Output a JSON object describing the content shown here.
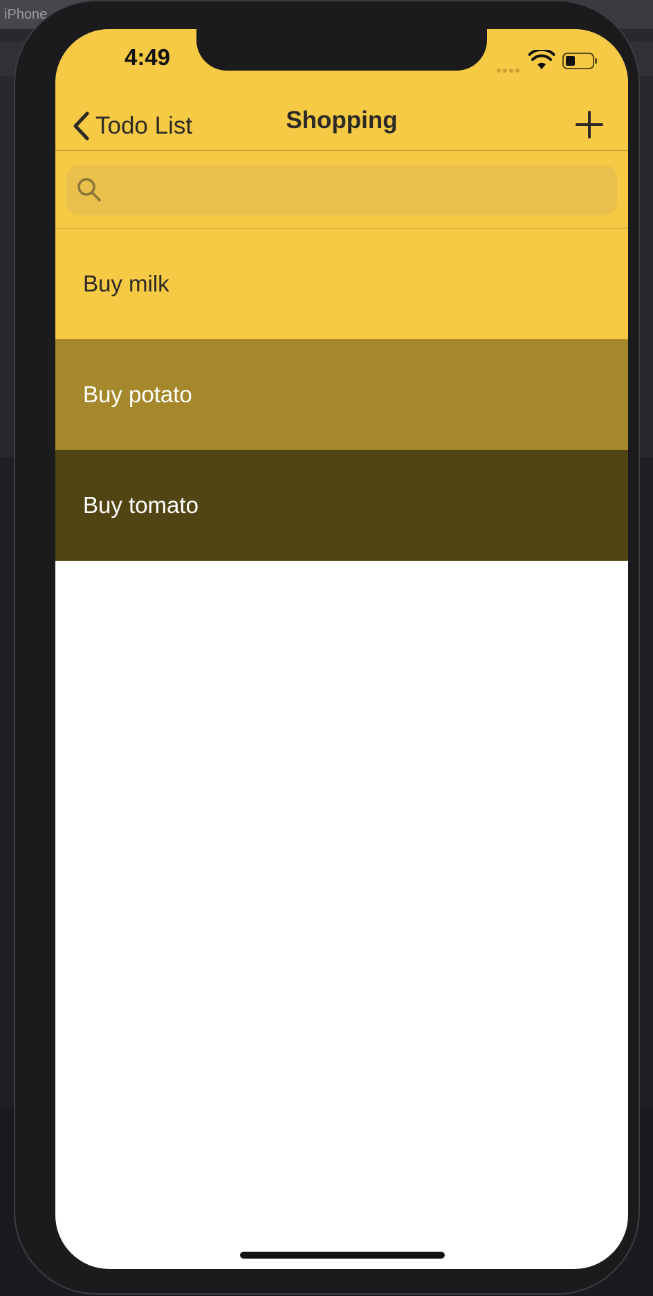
{
  "backdrop": {
    "tab_label": "iPhone"
  },
  "status_bar": {
    "time": "4:49"
  },
  "nav": {
    "back_label": "Todo List",
    "title": "Shopping",
    "add_icon": "plus-icon"
  },
  "search": {
    "placeholder": "",
    "icon": "search-icon"
  },
  "items": [
    {
      "label": "Buy milk",
      "background": "#f6ca45",
      "text_color": "#2b2a26"
    },
    {
      "label": "Buy potato",
      "background": "#a5882c",
      "text_color": "#ffffff"
    },
    {
      "label": "Buy tomato",
      "background": "#524514",
      "text_color": "#ffffff"
    }
  ],
  "colors": {
    "accent": "#f6ca45",
    "search_bg": "#e9c04b"
  }
}
